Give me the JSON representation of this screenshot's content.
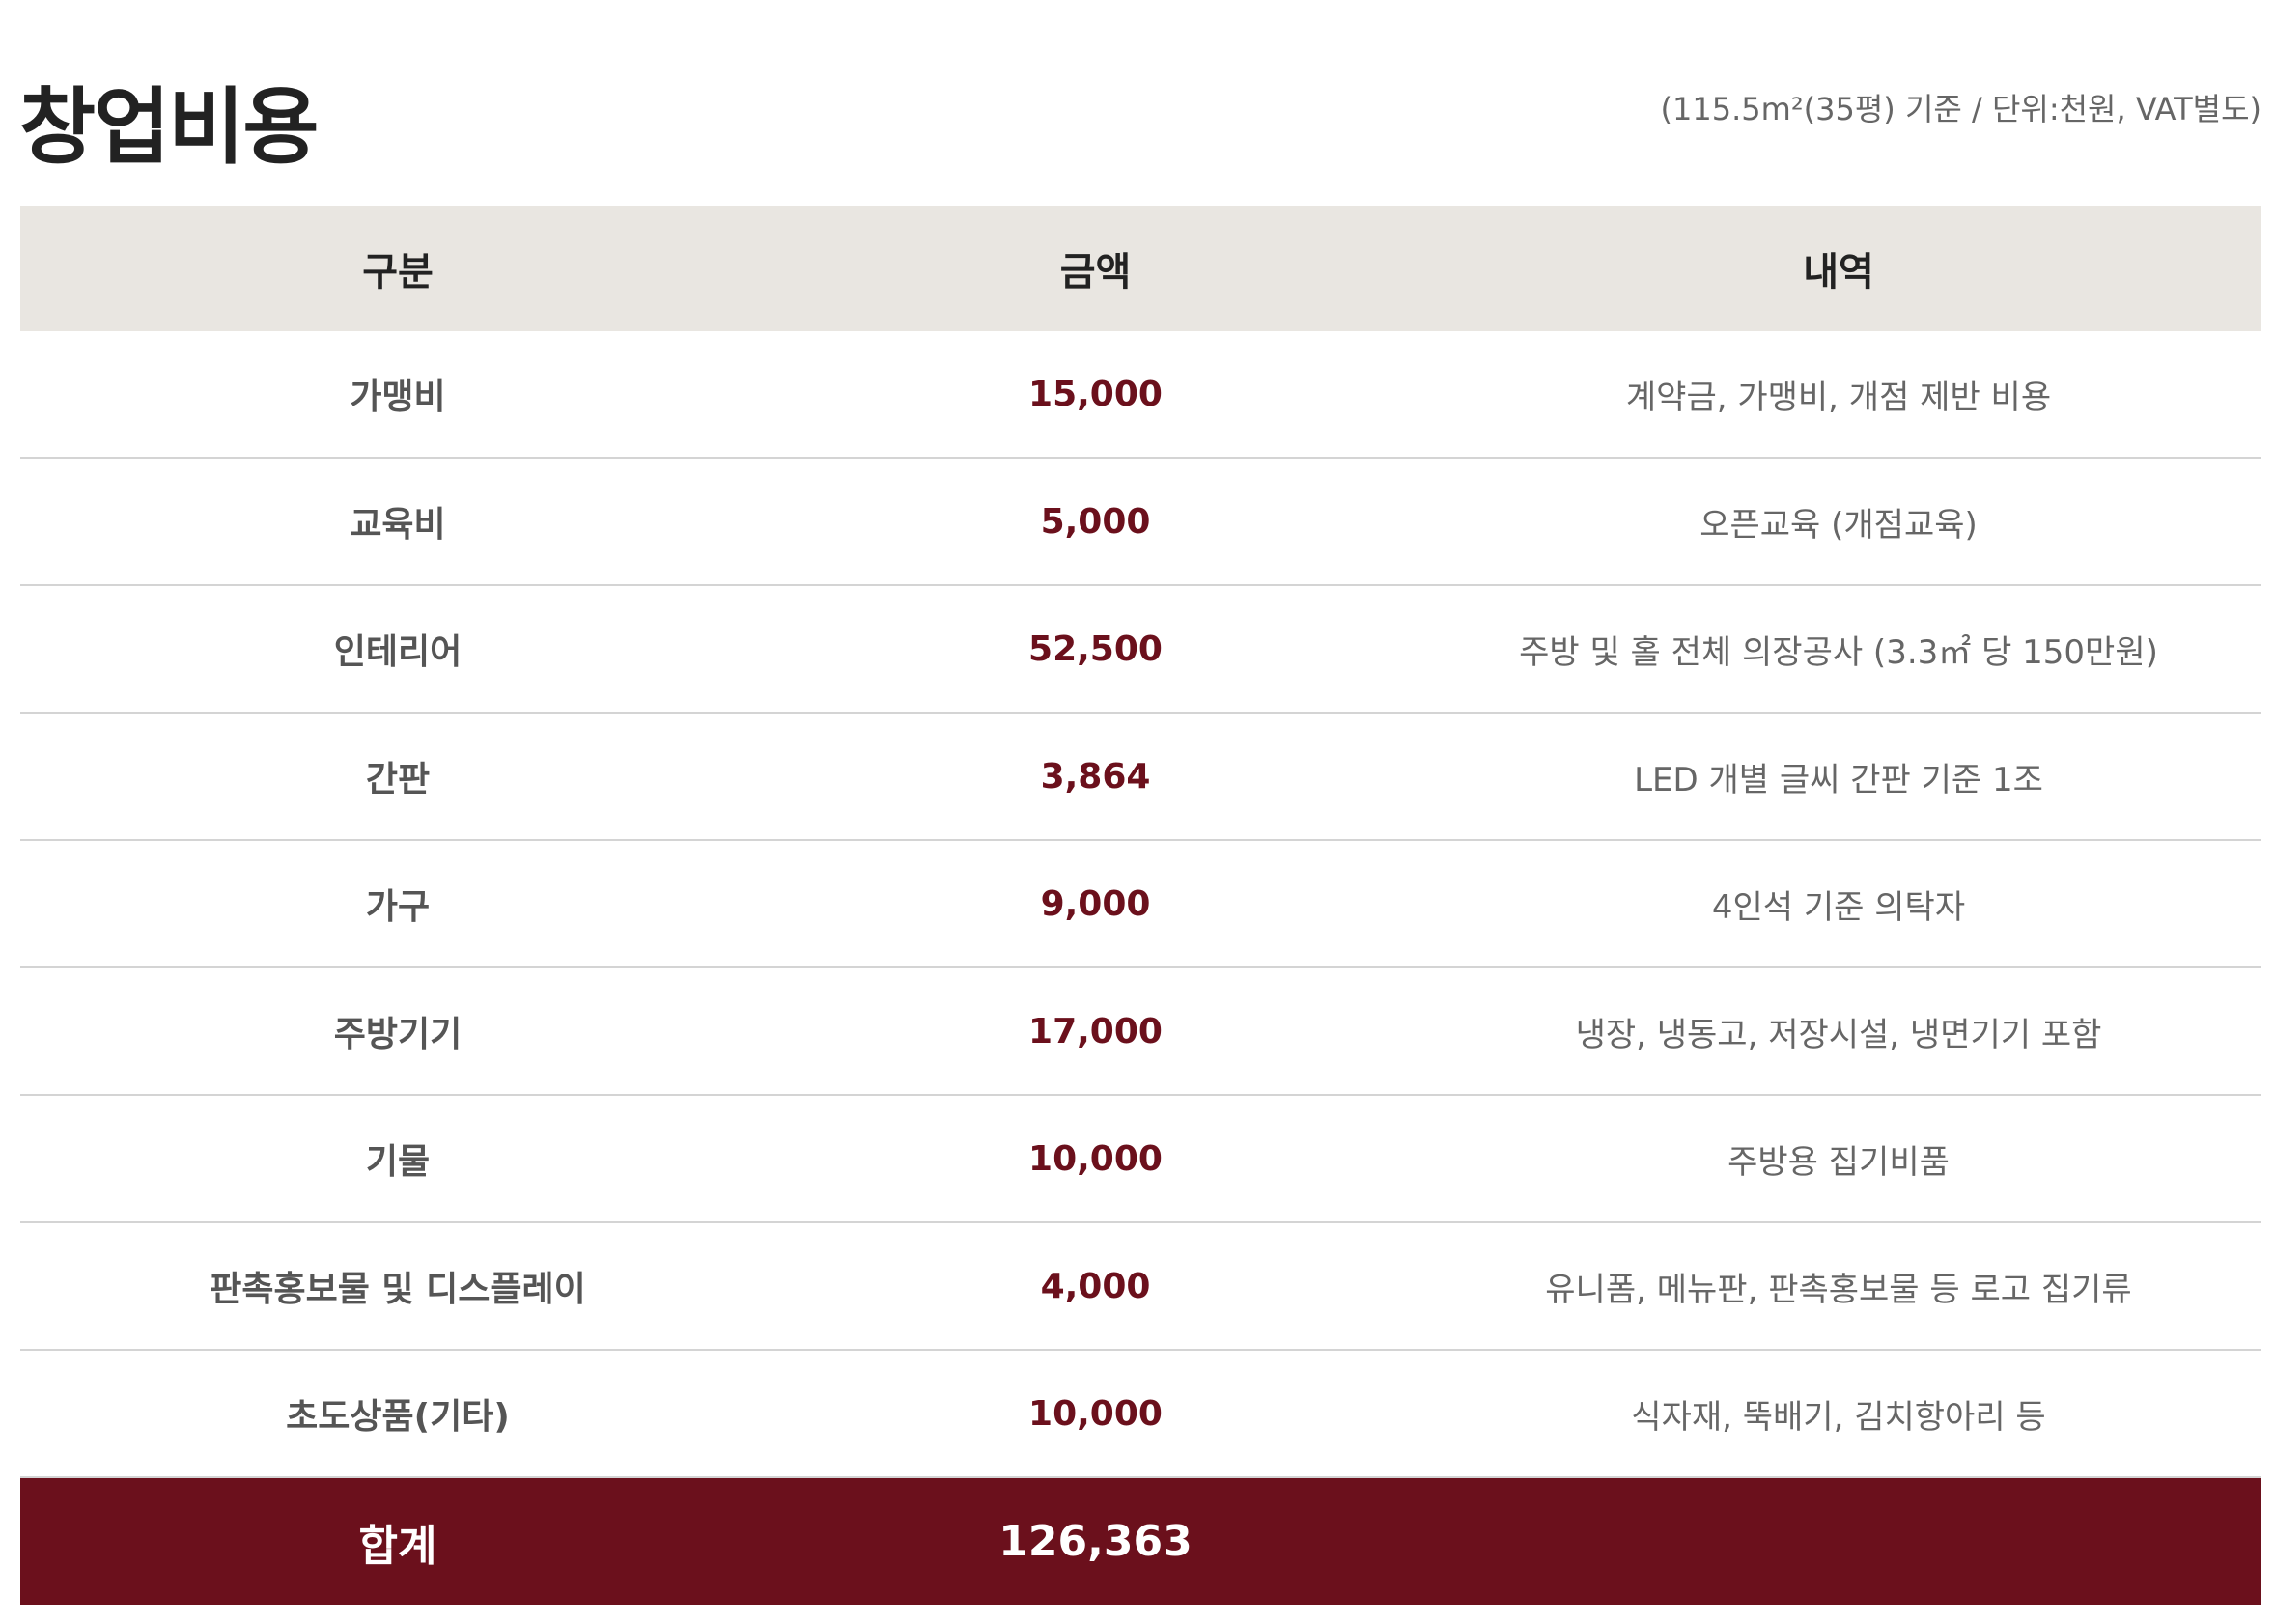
{
  "title": "창업비용",
  "unit_note": "(115.5m²(35평) 기준 / 단위:천원, VAT별도)",
  "table": {
    "headers": {
      "category": "구분",
      "amount": "금액",
      "details": "내역"
    },
    "rows": [
      {
        "category": "가맹비",
        "amount": "15,000",
        "details": "계약금, 가맹비, 개점 제반 비용"
      },
      {
        "category": "교육비",
        "amount": "5,000",
        "details": "오픈교육 (개점교육)"
      },
      {
        "category": "인테리어",
        "amount": "52,500",
        "details": "주방 및 홀 전체 의장공사 (3.3㎡ 당 150만원)"
      },
      {
        "category": "간판",
        "amount": "3,864",
        "details": "LED 개별 글씨 간판 기준 1조"
      },
      {
        "category": "가구",
        "amount": "9,000",
        "details": "4인석 기준 의탁자"
      },
      {
        "category": "주방기기",
        "amount": "17,000",
        "details": "냉장, 냉동고, 저장시설, 냉면기기 포함"
      },
      {
        "category": "기물",
        "amount": "10,000",
        "details": "주방용 집기비품"
      },
      {
        "category": "판촉홍보물 및 디스플레이",
        "amount": "4,000",
        "details": "유니폼, 메뉴판, 판촉홍보물 등 로고 집기류"
      },
      {
        "category": "초도상품(기타)",
        "amount": "10,000",
        "details": "식자재, 뚝배기, 김치항아리 등"
      }
    ],
    "total": {
      "label": "합계",
      "amount": "126,363"
    }
  },
  "colors": {
    "accent": "#6b101c",
    "header_bg": "#e9e6e1",
    "divider": "#d4d4d4"
  }
}
